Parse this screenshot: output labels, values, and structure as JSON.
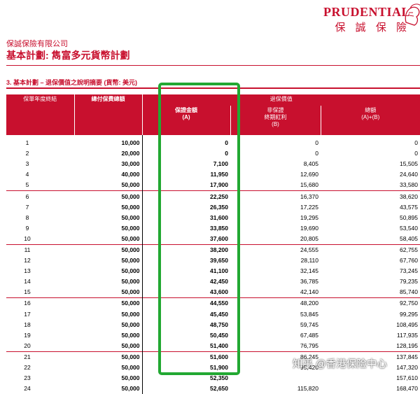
{
  "logo": {
    "en": "PRUDENTIAL",
    "zh": "保 誠 保 險"
  },
  "header": {
    "company": "保誠保險有限公司",
    "plan": "基本計劃: 雋富多元貨幣計劃",
    "section": "3.  基本計劃 – 退保價值之說明摘要 (貨幣: 美元)"
  },
  "table": {
    "col_year": "保單年度終結",
    "col_premium": "總付保費總額",
    "col_surrender_group": "退保價值",
    "col_guaranteed": "保證金額",
    "col_guaranteed_sub": "(A)",
    "col_bonus": "非保證",
    "col_bonus_sub1": "終期紅利",
    "col_bonus_sub2": "(B)",
    "col_total": "總額",
    "col_total_sub": "(A)+(B)",
    "rows": [
      [
        "1",
        "10,000",
        "0",
        "0",
        "0"
      ],
      [
        "2",
        "20,000",
        "0",
        "0",
        "0"
      ],
      [
        "3",
        "30,000",
        "7,100",
        "8,405",
        "15,505"
      ],
      [
        "4",
        "40,000",
        "11,950",
        "12,690",
        "24,640"
      ],
      [
        "5",
        "50,000",
        "17,900",
        "15,680",
        "33,580"
      ],
      [
        "6",
        "50,000",
        "22,250",
        "16,370",
        "38,620"
      ],
      [
        "7",
        "50,000",
        "26,350",
        "17,225",
        "43,575"
      ],
      [
        "8",
        "50,000",
        "31,600",
        "19,295",
        "50,895"
      ],
      [
        "9",
        "50,000",
        "33,850",
        "19,690",
        "53,540"
      ],
      [
        "10",
        "50,000",
        "37,600",
        "20,805",
        "58,405"
      ],
      [
        "11",
        "50,000",
        "38,200",
        "24,555",
        "62,755"
      ],
      [
        "12",
        "50,000",
        "39,650",
        "28,110",
        "67,760"
      ],
      [
        "13",
        "50,000",
        "41,100",
        "32,145",
        "73,245"
      ],
      [
        "14",
        "50,000",
        "42,450",
        "36,785",
        "79,235"
      ],
      [
        "15",
        "50,000",
        "43,600",
        "42,140",
        "85,740"
      ],
      [
        "16",
        "50,000",
        "44,550",
        "48,200",
        "92,750"
      ],
      [
        "17",
        "50,000",
        "45,450",
        "53,845",
        "99,295"
      ],
      [
        "18",
        "50,000",
        "48,750",
        "59,745",
        "108,495"
      ],
      [
        "19",
        "50,000",
        "50,450",
        "67,485",
        "117,935"
      ],
      [
        "20",
        "50,000",
        "51,400",
        "76,795",
        "128,195"
      ],
      [
        "21",
        "50,000",
        "51,600",
        "86,245",
        "137,845"
      ],
      [
        "22",
        "50,000",
        "51,900",
        "95,420",
        "147,320"
      ],
      [
        "23",
        "50,000",
        "52,350",
        "",
        "157,610"
      ],
      [
        "24",
        "50,000",
        "52,650",
        "115,820",
        "168,470"
      ]
    ]
  },
  "watermark": "知乎 @香港保险中心",
  "colors": {
    "brand_red": "#c8102e",
    "highlight_green": "#22a832"
  }
}
